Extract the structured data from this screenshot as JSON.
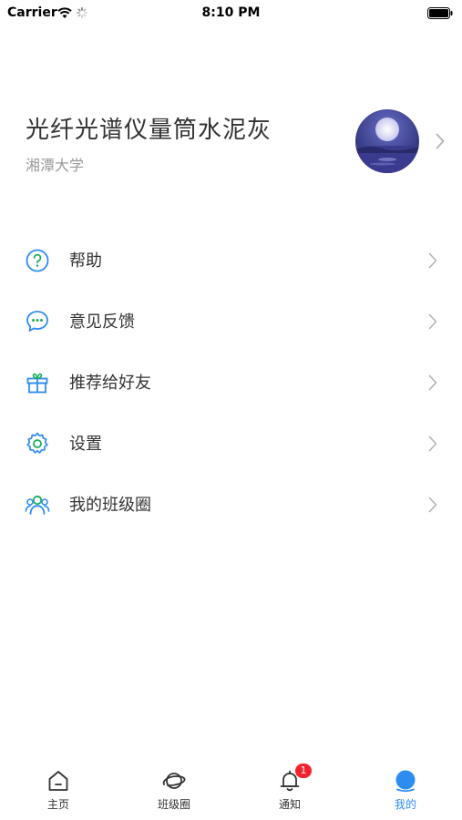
{
  "status_bar": {
    "carrier": "Carrier",
    "time": "8:10 PM"
  },
  "profile": {
    "name": "光纤光谱仪量筒水泥灰",
    "school": "湘潭大学"
  },
  "menu": [
    {
      "label": "帮助",
      "icon": "help-icon"
    },
    {
      "label": "意见反馈",
      "icon": "feedback-icon"
    },
    {
      "label": "推荐给好友",
      "icon": "gift-icon"
    },
    {
      "label": "设置",
      "icon": "gear-icon"
    },
    {
      "label": "我的班级圈",
      "icon": "group-icon"
    }
  ],
  "tabs": [
    {
      "label": "主页",
      "icon": "home-icon"
    },
    {
      "label": "班级圈",
      "icon": "planet-icon"
    },
    {
      "label": "通知",
      "icon": "bell-icon",
      "badge": "1"
    },
    {
      "label": "我的",
      "icon": "profile-icon",
      "active": true
    }
  ],
  "colors": {
    "accent": "#2d8cf0",
    "badge": "#f5222d"
  }
}
